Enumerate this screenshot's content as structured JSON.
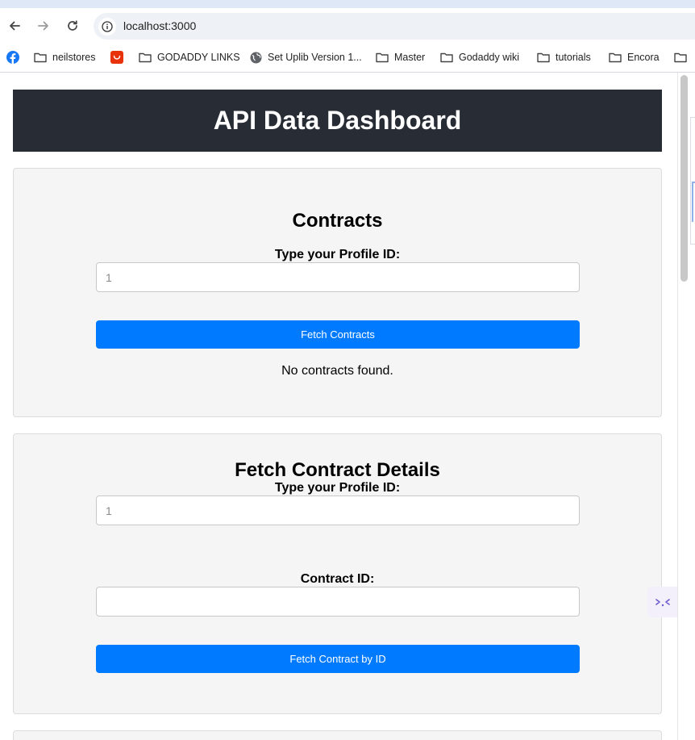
{
  "browser": {
    "url": "localhost:3000",
    "bookmarks": [
      {
        "label": "",
        "icon": "facebook-icon"
      },
      {
        "label": "neilstores",
        "icon": "folder-icon"
      },
      {
        "label": "",
        "icon": "aliexpress-icon"
      },
      {
        "label": "GODADDY LINKS",
        "icon": "folder-icon"
      },
      {
        "label": "Set Uplib Version 1...",
        "icon": "globe-icon"
      },
      {
        "label": "Master",
        "icon": "folder-icon"
      },
      {
        "label": "Godaddy wiki",
        "icon": "folder-icon"
      },
      {
        "label": "tutorials",
        "icon": "folder-icon"
      },
      {
        "label": "Encora",
        "icon": "folder-icon"
      },
      {
        "label": "",
        "icon": "folder-icon"
      }
    ]
  },
  "page": {
    "title": "API Data Dashboard",
    "contracts": {
      "heading": "Contracts",
      "profile_label": "Type your Profile ID:",
      "profile_placeholder": "1",
      "button_label": "Fetch Contracts",
      "status": "No contracts found."
    },
    "details": {
      "heading": "Fetch Contract Details",
      "profile_label": "Type your Profile ID:",
      "profile_placeholder": "1",
      "contract_label": "Contract ID:",
      "contract_value": "",
      "button_label": "Fetch Contract by ID"
    }
  },
  "colors": {
    "header_bg": "#282c34",
    "accent": "#007bff",
    "card_bg": "#f5f5f5"
  }
}
